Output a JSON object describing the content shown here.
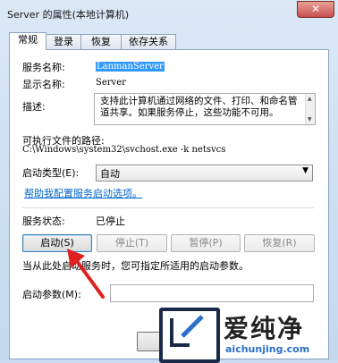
{
  "window": {
    "title": "Server 的属性(本地计算机)",
    "close_label": "✕"
  },
  "tabs": [
    {
      "label": "常规"
    },
    {
      "label": "登录"
    },
    {
      "label": "恢复"
    },
    {
      "label": "依存关系"
    }
  ],
  "general": {
    "service_name_label": "服务名称:",
    "service_name_value": "LanmanServer",
    "display_name_label": "显示名称:",
    "display_name_value": "Server",
    "description_label": "描述:",
    "description_value": "支持此计算机通过网络的文件、打印、和命名管道共享。如果服务停止，这些功能不可用。",
    "exe_path_label": "可执行文件的路径:",
    "exe_path_value": "C:\\Windows\\system32\\svchost.exe -k netsvcs",
    "startup_type_label": "启动类型(E):",
    "startup_type_value": "自动",
    "help_link": "帮助我配置服务启动选项。",
    "status_label": "服务状态:",
    "status_value": "已停止",
    "buttons": {
      "start": "启动(S)",
      "stop": "停止(T)",
      "pause": "暂停(P)",
      "resume": "恢复(R)"
    },
    "hint_text": "当从此处启动服务时，您可指定所适用的启动参数。",
    "start_params_label": "启动参数(M):",
    "start_params_value": ""
  },
  "watermark": {
    "brand": "爱纯净",
    "url": "aichunjing.com"
  },
  "colors": {
    "selection": "#3399ff",
    "link": "#0066cc",
    "arrow": "#e02020"
  }
}
